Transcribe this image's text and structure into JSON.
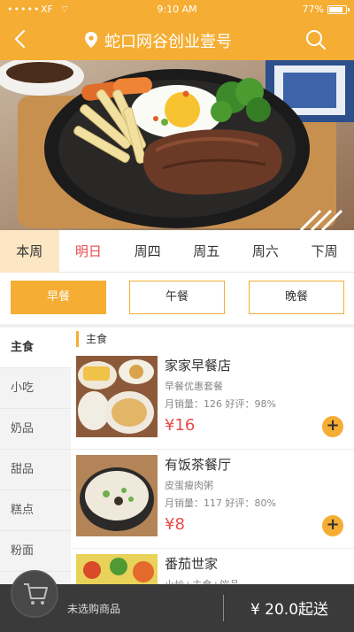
{
  "status": {
    "signal": "•••••",
    "carrier": "XF",
    "network": "⌔",
    "time": "9:10 AM",
    "battery": "77%"
  },
  "header": {
    "title": "蛇口网谷创业壹号"
  },
  "days": [
    "本周",
    "明日",
    "周四",
    "周五",
    "周六",
    "下周"
  ],
  "meals": [
    "早餐",
    "午餐",
    "晚餐"
  ],
  "categories": [
    "主食",
    "小吃",
    "奶品",
    "甜品",
    "糕点",
    "粉面"
  ],
  "section_title": "主食",
  "items": [
    {
      "name": "家家早餐店",
      "desc": "早餐优惠套餐",
      "stats": "月销量：126   好评：98%",
      "price": "¥16",
      "add": "+"
    },
    {
      "name": "有饭茶餐厅",
      "desc": "皮蛋瘦肉粥",
      "stats": "月销量：117   好评：80%",
      "price": "¥8",
      "add": "+"
    },
    {
      "name": "番茄世家",
      "desc": "小炒+主食+饮品",
      "stats": "",
      "price": "",
      "add": ""
    }
  ],
  "bottom": {
    "cart_text": "未选购商品",
    "checkout": "¥ 20.0起送"
  },
  "colors": {
    "accent": "#f5ad33",
    "price": "#e84a4a",
    "dark_bar": "#3a3a3a"
  }
}
